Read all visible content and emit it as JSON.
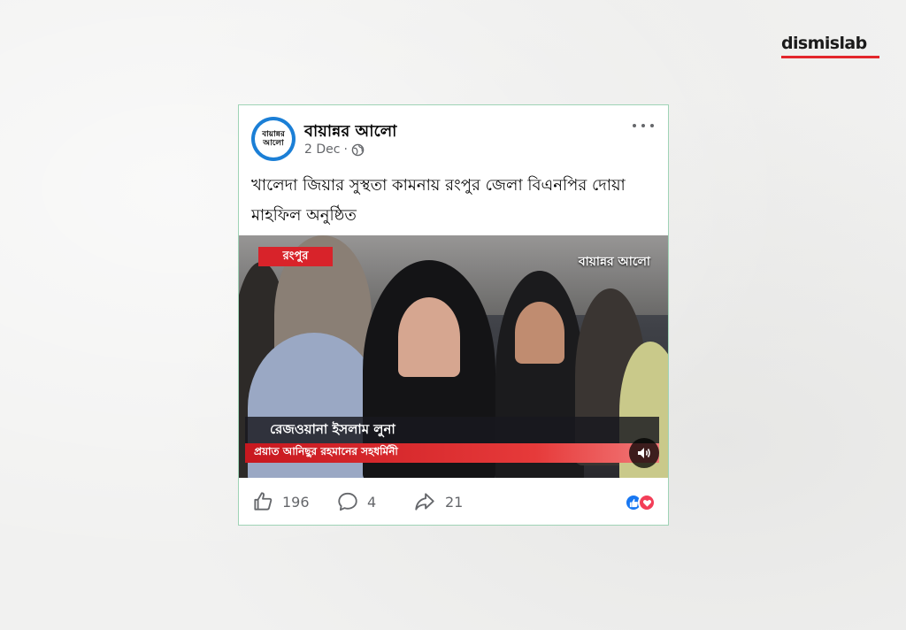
{
  "brand": {
    "name": "dismislab",
    "accent_color": "#e3262c"
  },
  "post": {
    "page_name": "বায়ান্নর আলো",
    "avatar_text": "বায়ান্নর আলো",
    "date": "2 Dec",
    "separator": "·",
    "audience_icon": "globe-icon",
    "more_icon": "more-options-icon",
    "caption": "খালেদা জিয়ার সুস্থতা কামনায় রংপুর জেলা বিএনপির দোয়া মাহফিল অনুষ্ঠিত",
    "video": {
      "location_tag": "রংপুর",
      "watermark": "বায়ান্নর আলো",
      "speaker_name": "রেজওয়ানা ইসলাম লুনা",
      "speaker_title": "প্রয়াত আনিছুর রহমানের সহধর্মিনী",
      "sound_icon": "speaker-icon"
    },
    "stats": {
      "likes": "196",
      "comments": "4",
      "shares": "21"
    },
    "reactions": [
      "like-icon",
      "love-icon"
    ],
    "card_border_color": "#9fd3b6"
  }
}
